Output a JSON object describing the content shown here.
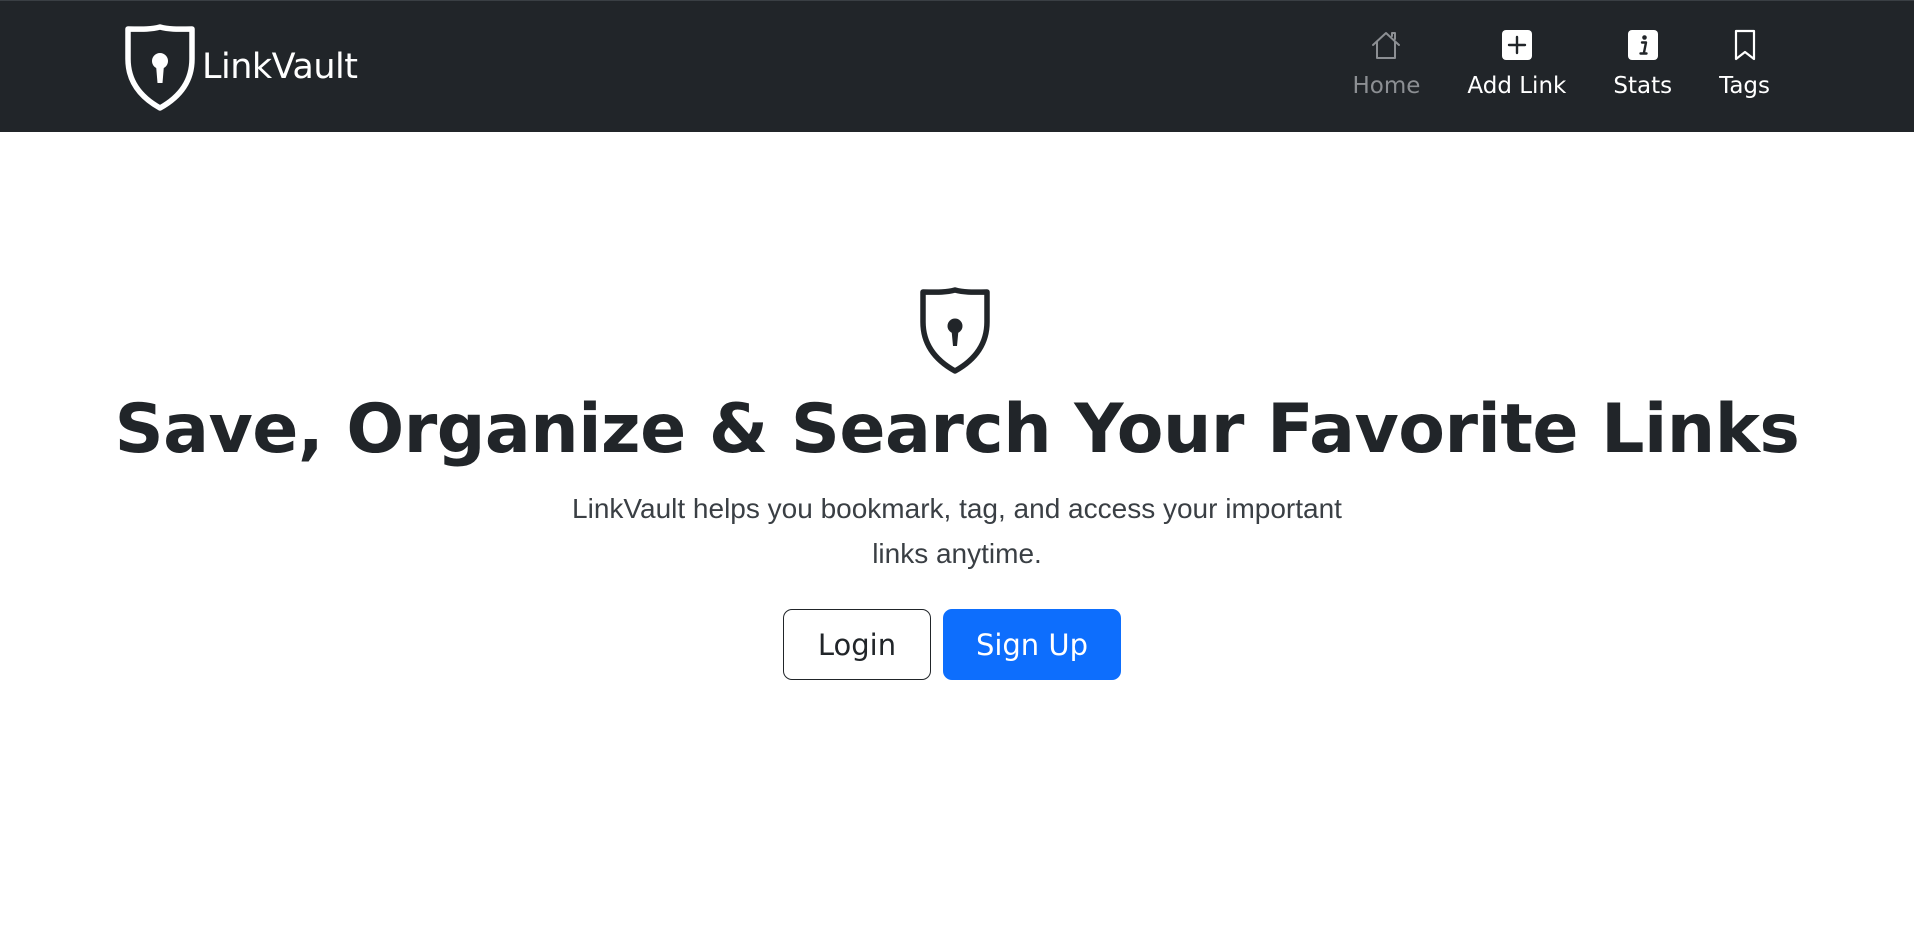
{
  "brand": {
    "name": "LinkVault"
  },
  "nav": {
    "items": [
      {
        "label": "Home",
        "icon": "home-icon"
      },
      {
        "label": "Add Link",
        "icon": "plus-square-icon"
      },
      {
        "label": "Stats",
        "icon": "info-square-icon"
      },
      {
        "label": "Tags",
        "icon": "bookmark-icon"
      }
    ]
  },
  "hero": {
    "icon": "shield-lock-icon",
    "title": "Save, Organize & Search Your Favorite Links",
    "subtitle": "LinkVault helps you bookmark, tag, and access your important links anytime."
  },
  "actions": {
    "login_label": "Login",
    "signup_label": "Sign Up"
  },
  "colors": {
    "navbar_bg": "#212529",
    "primary": "#0d6efd",
    "text": "#212529",
    "muted_nav": "#8c8f93"
  }
}
